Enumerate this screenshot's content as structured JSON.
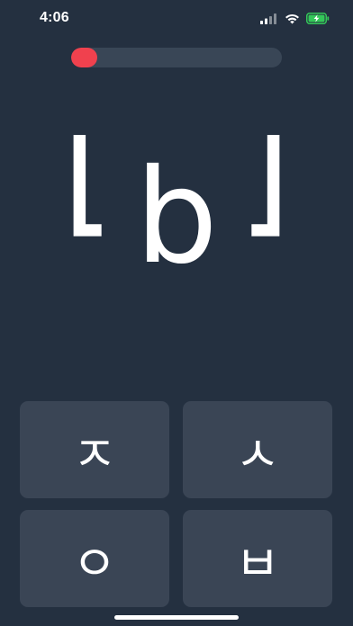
{
  "status_bar": {
    "time": "4:06",
    "icons": [
      "cellular-signal-icon",
      "wifi-icon",
      "battery-charging-icon"
    ],
    "battery_color": "#34c759"
  },
  "progress": {
    "fraction": 0.125,
    "fill_color": "#f0414e"
  },
  "prompt": {
    "open_bracket": "[",
    "letter": "b",
    "close_bracket": "]"
  },
  "answers": [
    {
      "label": "ㅈ"
    },
    {
      "label": "ㅅ"
    },
    {
      "label": "ㅇ"
    },
    {
      "label": "ㅂ"
    }
  ],
  "colors": {
    "background": "#243040",
    "button": "#3a4555",
    "track": "#394656"
  }
}
